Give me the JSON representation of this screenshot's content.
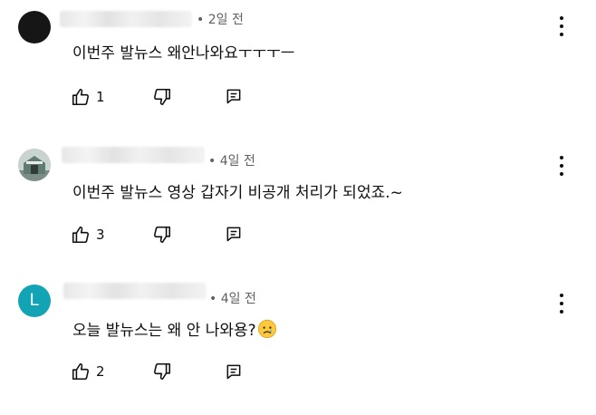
{
  "comments": [
    {
      "time": "• 2일 전",
      "text": "이번주 발뉴스 왜안나와요ㅜㅜㅜㅡ",
      "like_count": "1",
      "avatar_letter": ""
    },
    {
      "time": "• 4일 전",
      "text": "이번주 발뉴스 영상 갑자기 비공개 처리가 되었죠.~",
      "like_count": "3",
      "avatar_letter": ""
    },
    {
      "time": "• 4일 전",
      "text": "오늘 발뉴스는 왜 안 나와용?",
      "like_count": "2",
      "avatar_letter": "L"
    }
  ],
  "icons": {
    "like": "thumbs-up-icon",
    "dislike": "thumbs-down-icon",
    "reply": "reply-icon",
    "more": "more-vertical-icon",
    "emoji": "sad-face-emoji"
  },
  "colors": {
    "text": "#0f0f0f",
    "meta": "#606060",
    "avatar_letter_bg": "#12a4b4"
  }
}
